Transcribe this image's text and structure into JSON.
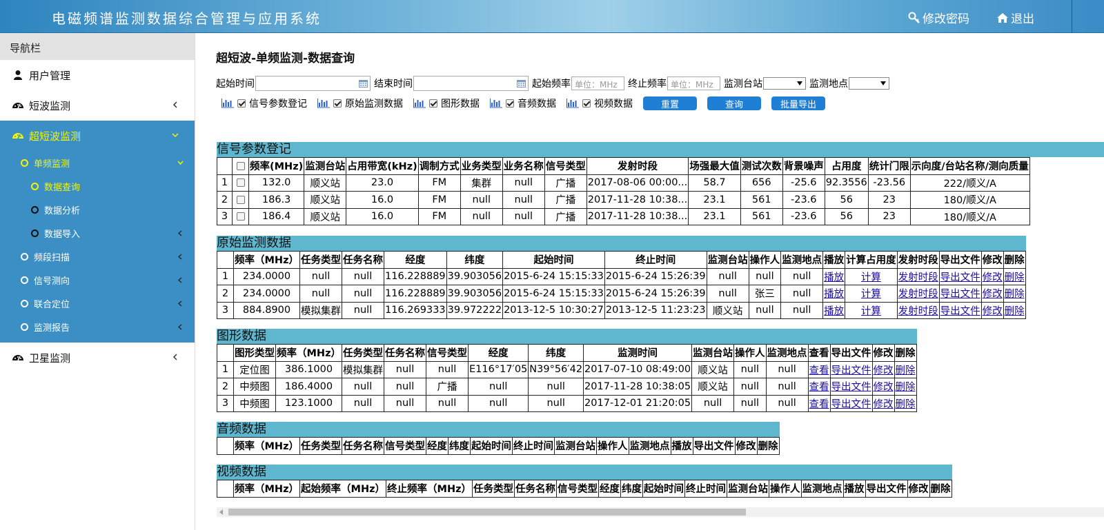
{
  "app": {
    "title": "电磁频谱监测数据综合管理与应用系统",
    "change_password": "修改密码",
    "logout": "退出"
  },
  "sidebar": {
    "header": "导航栏",
    "user_mgmt": "用户管理",
    "shortwave": "短波监测",
    "ultrashort": "超短波监测",
    "single_freq": "单频监测",
    "data_query": "数据查询",
    "data_analysis": "数据分析",
    "data_import": "数据导入",
    "band_scan": "频段扫描",
    "direction": "信号测向",
    "joint_loc": "联合定位",
    "report": "监测报告",
    "satellite": "卫星监测"
  },
  "page": {
    "title": "超短波-单频监测-数据查询"
  },
  "filters": {
    "start_time": "起始时间",
    "end_time": "结束时间",
    "start_freq": "起始频率",
    "end_freq": "终止频率",
    "freq_placeholder": "单位：MHz",
    "station": "监测台站",
    "location": "监测地点"
  },
  "checks": {
    "signal_params": "信号参数登记",
    "raw_data": "原始监测数据",
    "graph_data": "图形数据",
    "audio_data": "音频数据",
    "video_data": "视频数据"
  },
  "buttons": {
    "reset": "重置",
    "query": "查询",
    "batch_export": "批量导出"
  },
  "signal_table": {
    "title": "信号参数登记",
    "headers": [
      "频率(MHz)",
      "监测台站",
      "占用带宽(kHz)",
      "调制方式",
      "业务类型",
      "业务名称",
      "信号类型",
      "发射时段",
      "场强最大值",
      "测试次数",
      "背景噪声",
      "占用度",
      "统计门限",
      "示向度/台站名称/测向质量"
    ],
    "rows": [
      [
        "1",
        "132.0",
        "顺义站",
        "23.0",
        "FM",
        "集群",
        "null",
        "广播",
        "2017-08-06 00:00...",
        "58.7",
        "656",
        "-25.6",
        "92.3556",
        "-23.56",
        "222/顺义/A"
      ],
      [
        "2",
        "186.3",
        "顺义站",
        "16.0",
        "FM",
        "null",
        "null",
        "广播",
        "2017-11-28 10:38...",
        "23.1",
        "561",
        "-23.6",
        "56",
        "23",
        "180/顺义/A"
      ],
      [
        "3",
        "186.4",
        "顺义站",
        "16.0",
        "FM",
        "null",
        "null",
        "广播",
        "2017-11-28 10:38...",
        "23.1",
        "561",
        "-23.6",
        "56",
        "23",
        "180/顺义/A"
      ]
    ]
  },
  "raw_table": {
    "title": "原始监测数据",
    "headers": [
      "频率（MHz）",
      "任务类型",
      "任务名称",
      "经度",
      "纬度",
      "起始时间",
      "终止时间",
      "监测台站",
      "操作人",
      "监测地点",
      "播放",
      "计算占用度",
      "发射时段",
      "导出文件",
      "修改",
      "删除"
    ],
    "rows": [
      [
        "1",
        "234.0000",
        "null",
        "null",
        "116.228889",
        "39.903056",
        "2015-6-24 15:15:33",
        "2015-6-24 15:26:39",
        "null",
        "null",
        "null"
      ],
      [
        "2",
        "234.0000",
        "null",
        "null",
        "116.228889",
        "39.903056",
        "2015-6-24 15:15:33",
        "2015-6-24 15:26:39",
        "null",
        "张三",
        "null"
      ],
      [
        "3",
        "884.8900",
        "模拟集群",
        "null",
        "116.269333",
        "39.972222",
        "2013-12-5 10:30:27",
        "2013-12-5 11:23:23",
        "顺义站",
        "null",
        "null"
      ]
    ],
    "links": [
      "播放",
      "计算",
      "发射时段",
      "导出文件",
      "修改",
      "删除"
    ]
  },
  "graph_table": {
    "title": "图形数据",
    "headers": [
      "图形类型",
      "频率（MHz）",
      "任务类型",
      "任务名称",
      "信号类型",
      "经度",
      "纬度",
      "监测时间",
      "监测台站",
      "操作人",
      "监测地点",
      "查看",
      "导出文件",
      "修改",
      "删除"
    ],
    "rows": [
      [
        "1",
        "定位图",
        "386.1000",
        "模拟集群",
        "null",
        "null",
        "E116°17′05",
        "N39°56′42",
        "2017-07-10 08:49:00",
        "顺义站",
        "null",
        "null"
      ],
      [
        "2",
        "中频图",
        "186.4000",
        "null",
        "null",
        "广播",
        "null",
        "null",
        "2017-11-28 10:38:05",
        "顺义站",
        "null",
        "null"
      ],
      [
        "3",
        "中频图",
        "123.1000",
        "null",
        "null",
        "null",
        "null",
        "null",
        "2017-12-01 21:20:05",
        "null",
        "null",
        "null"
      ]
    ],
    "links": [
      "查看",
      "导出文件",
      "修改",
      "删除"
    ]
  },
  "audio_table": {
    "title": "音频数据",
    "headers": [
      "频率（MHz）",
      "任务类型",
      "任务名称",
      "信号类型",
      "经度",
      "纬度",
      "起始时间",
      "终止时间",
      "监测台站",
      "操作人",
      "监测地点",
      "播放",
      "导出文件",
      "修改",
      "删除"
    ]
  },
  "video_table": {
    "title": "视频数据",
    "headers": [
      "频率（MHz）",
      "起始频率（MHz）",
      "终止频率（MHz）",
      "任务类型",
      "任务名称",
      "信号类型",
      "经度",
      "纬度",
      "起始时间",
      "终止时间",
      "监测台站",
      "操作人",
      "监测地点",
      "播放",
      "导出文件",
      "修改",
      "删除"
    ]
  }
}
